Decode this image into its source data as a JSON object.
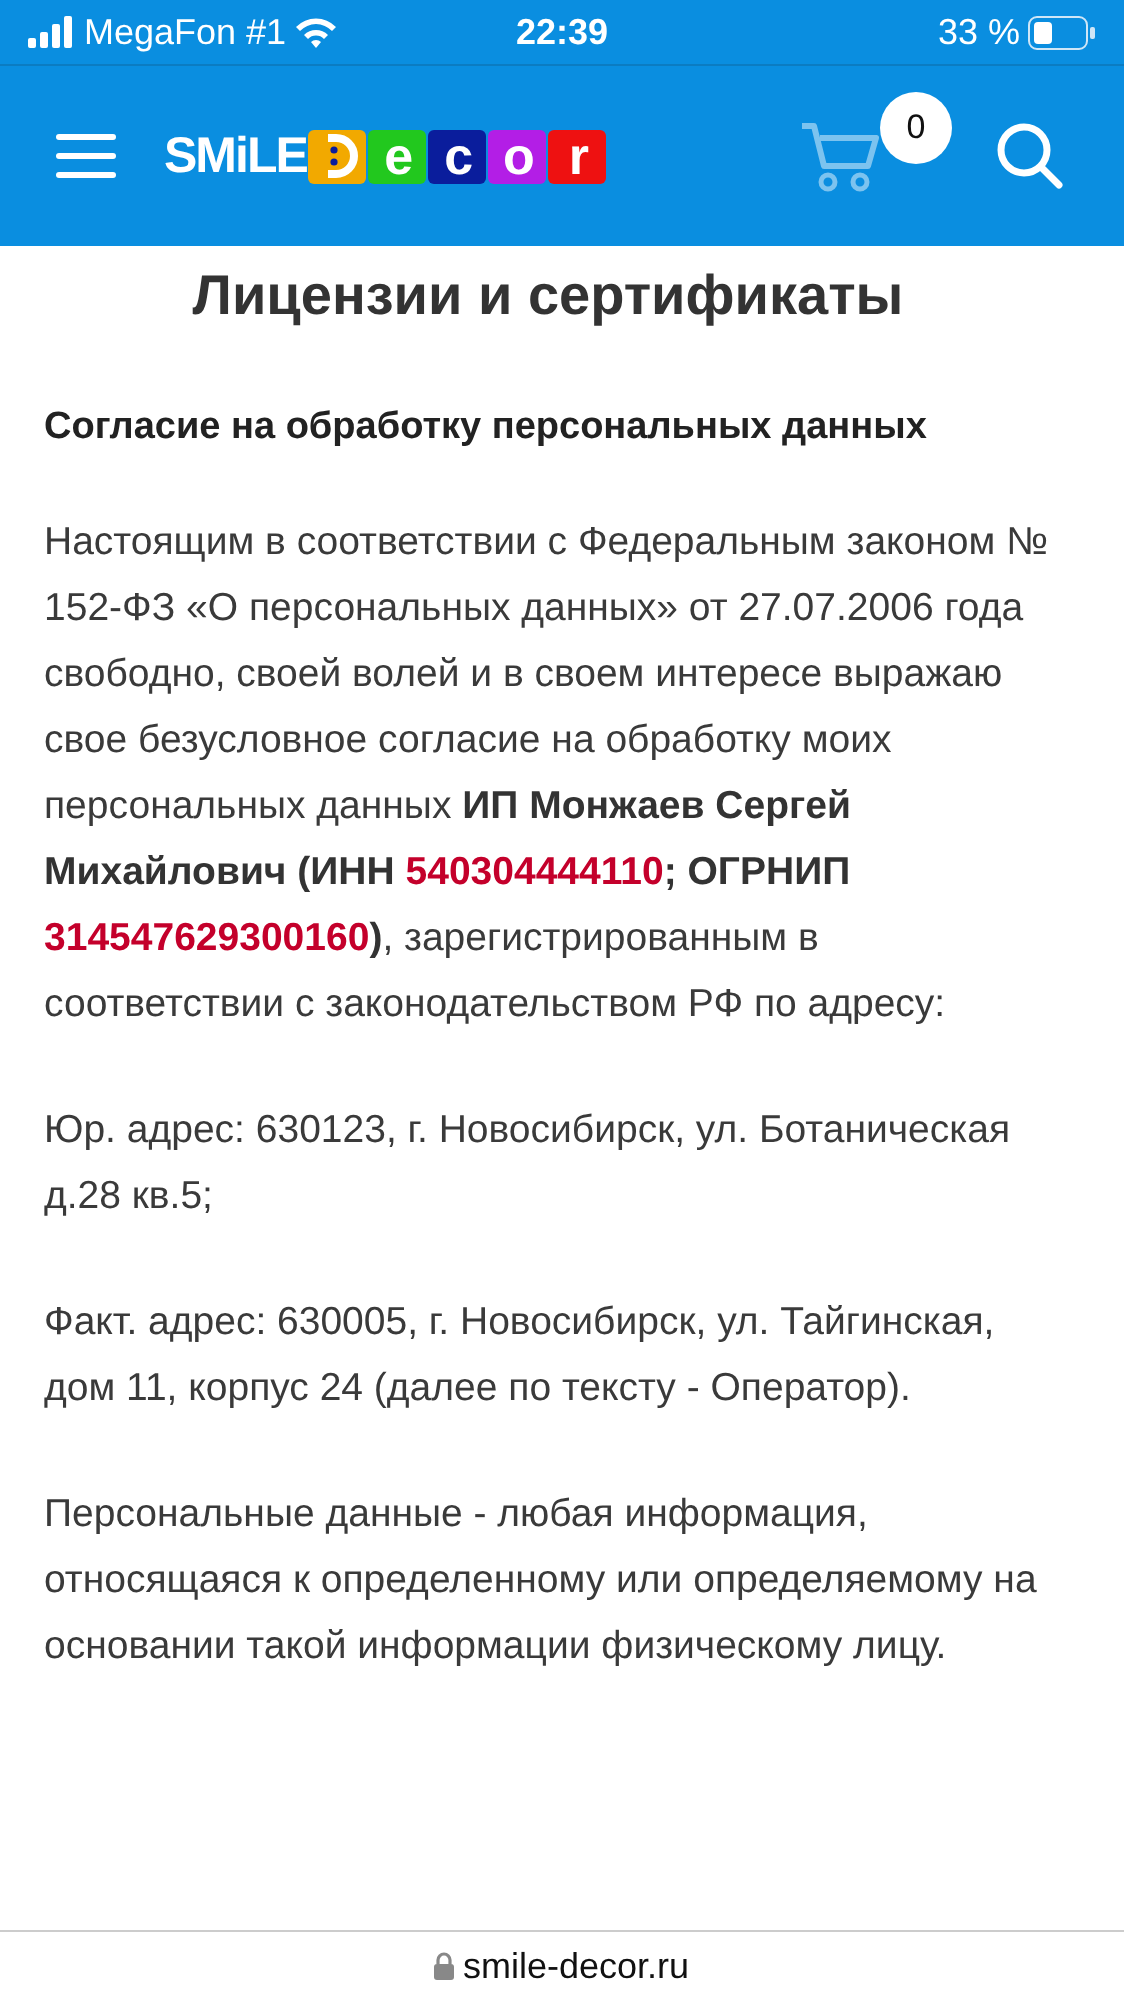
{
  "status_bar": {
    "carrier": "MegaFon #1",
    "time": "22:39",
    "battery": "33 %"
  },
  "header": {
    "logo": {
      "prefix": "SMiLE",
      "tiles": [
        {
          "kind": "smile",
          "color": "#f2a900"
        },
        {
          "kind": "letter",
          "letter": "e",
          "color": "#22c81e"
        },
        {
          "kind": "letter",
          "letter": "c",
          "color": "#0a1d9c"
        },
        {
          "kind": "letter",
          "letter": "o",
          "color": "#b31ee6"
        },
        {
          "kind": "letter",
          "letter": "r",
          "color": "#ee1111"
        }
      ]
    },
    "cart_count": "0"
  },
  "title": "Лицензии и сертификаты",
  "subtitle": "Согласие на обработку персональных данных",
  "paragraphs": [
    {
      "segments": [
        {
          "kind": "plain",
          "text": "Настоящим в соответствии с Федеральным законом № 152-ФЗ «О персональных данных» от 27.07.2006 года свободно, своей волей и в своем интересе выражаю свое безусловное согласие на обработку моих персональных данных "
        },
        {
          "kind": "bold",
          "text": "ИП Монжаев Сергей Михайлович (ИНН "
        },
        {
          "kind": "accent",
          "text": "540304444110"
        },
        {
          "kind": "bold",
          "text": "; ОГРНИП "
        },
        {
          "kind": "accent",
          "text": "314547629300160"
        },
        {
          "kind": "bold",
          "text": ")"
        },
        {
          "kind": "plain",
          "text": ", зарегистрированным в соответствии с законодательством РФ по адресу:"
        }
      ]
    },
    {
      "segments": [
        {
          "kind": "plain",
          "text": "Юр. адрес: 630123, г. Новосибирск, ул. Ботаническая д.28 кв.5;"
        }
      ]
    },
    {
      "segments": [
        {
          "kind": "plain",
          "text": "Факт. адрес: 630005, г. Новосибирск, ул. Тайгинская, дом 11, корпус 24 (далее по тексту - Оператор)."
        }
      ]
    },
    {
      "segments": [
        {
          "kind": "plain",
          "text": "Персональные данные - любая информация, относящаяся к определенному или определяемому на основании такой информации физическому лицу."
        }
      ]
    }
  ],
  "address_bar": {
    "url": "smile-decor.ru"
  }
}
